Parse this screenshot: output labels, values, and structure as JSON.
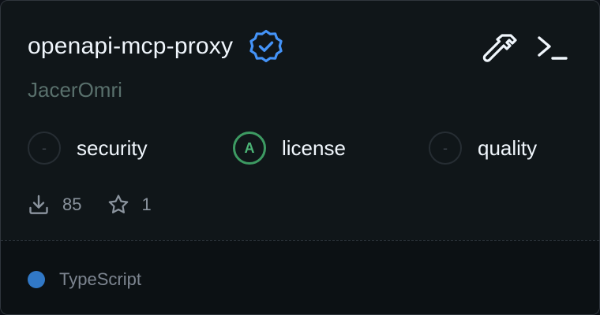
{
  "card": {
    "title": "openapi-mcp-proxy",
    "author": "JacerOmri",
    "verified_icon": "verified-badge-icon",
    "actions": [
      {
        "icon": "hammer-icon",
        "meaning": "tools"
      },
      {
        "icon": "terminal-icon",
        "meaning": "cli"
      }
    ],
    "scores": [
      {
        "grade": "-",
        "label": "security"
      },
      {
        "grade": "A",
        "label": "license"
      },
      {
        "grade": "-",
        "label": "quality"
      }
    ],
    "stats": {
      "downloads": "85",
      "stars": "1"
    },
    "language": {
      "name": "TypeScript",
      "color": "#3178c6"
    }
  },
  "colors": {
    "background": "#101619",
    "verified": "#4493f8",
    "grade_a": "#3d9a62",
    "text_primary": "#f0f6fc",
    "text_author": "#59706c"
  }
}
